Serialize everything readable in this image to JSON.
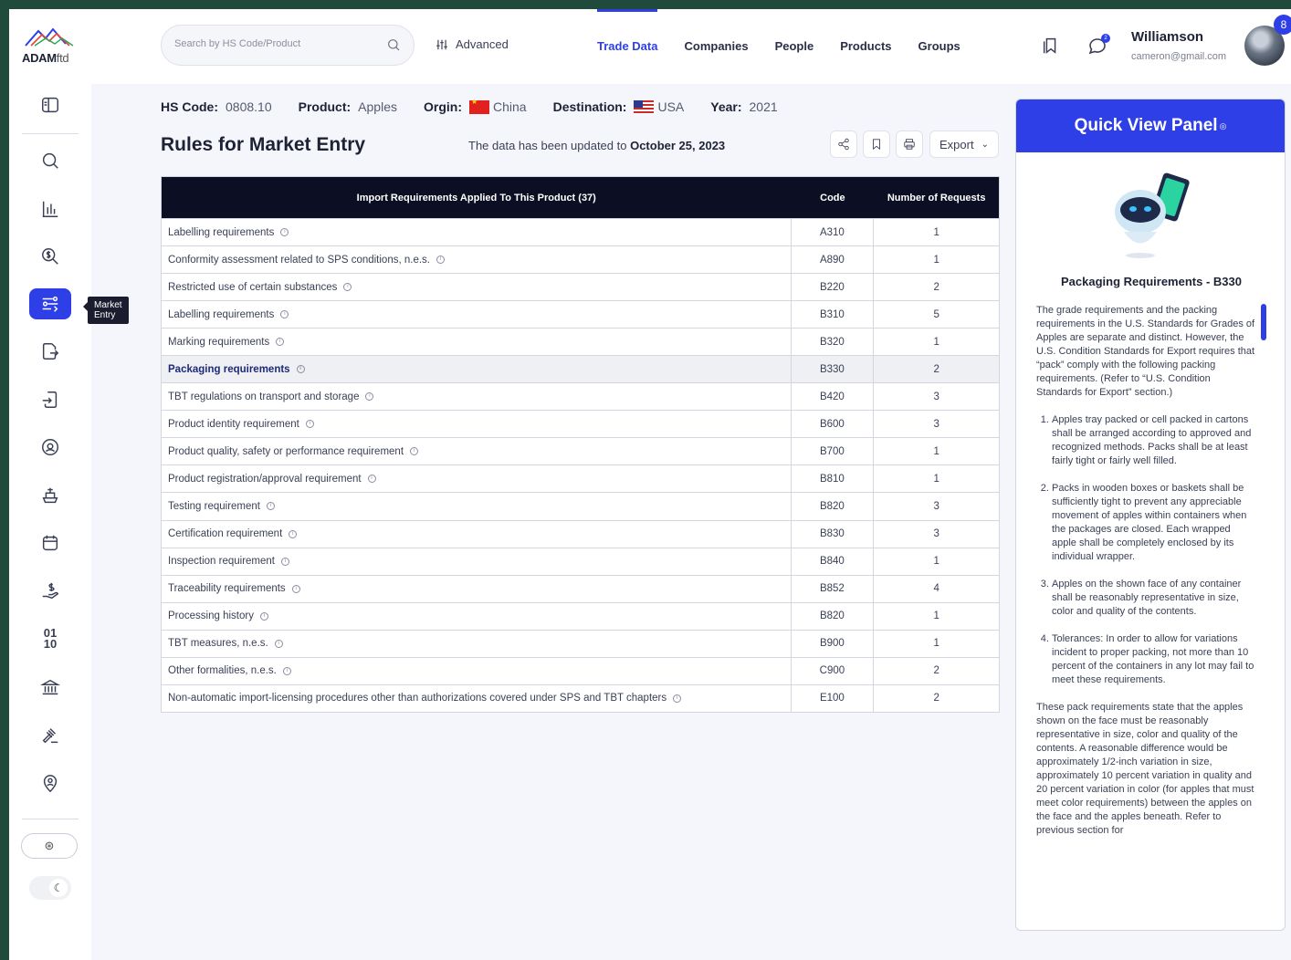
{
  "brand": {
    "name_bold": "ADAM",
    "name_light": "ftd"
  },
  "sidebar": {
    "items": [
      {
        "name": "sidebar-panel-icon"
      },
      {
        "name": "search-icon"
      },
      {
        "name": "bar-chart-icon"
      },
      {
        "name": "dollar-search-icon"
      },
      {
        "name": "market-entry-icon",
        "active": true
      },
      {
        "name": "export-doc-icon"
      },
      {
        "name": "import-doc-icon"
      },
      {
        "name": "location-icon"
      },
      {
        "name": "ship-icon"
      },
      {
        "name": "calendar-icon"
      },
      {
        "name": "hand-dollar-icon"
      },
      {
        "name": "binary-icon"
      },
      {
        "name": "bank-icon"
      },
      {
        "name": "gavel-icon"
      },
      {
        "name": "person-location-icon"
      }
    ],
    "tooltip": "Market Entry"
  },
  "header": {
    "search_placeholder": "Search by HS Code/Product",
    "advanced_label": "Advanced",
    "nav": [
      "Trade Data",
      "Companies",
      "People",
      "Products",
      "Groups"
    ],
    "active_nav": "Trade Data",
    "notification_badge": "2",
    "user_name": "Williamson",
    "user_email": "cameron@gmail.com",
    "avatar_badge": "8"
  },
  "meta": {
    "hs_label": "HS Code:",
    "hs_value": "0808.10",
    "product_label": "Product:",
    "product_value": "Apples",
    "origin_label": "Orgin:",
    "origin_value": "China",
    "destination_label": "Destination:",
    "destination_value": "USA",
    "year_label": "Year:",
    "year_value": "2021"
  },
  "page": {
    "title": "Rules for Market Entry",
    "updated_prefix": "The data has been updated to ",
    "updated_date": "October 25, 2023",
    "export_label": "Export"
  },
  "table": {
    "headers": [
      "Import Requirements Applied To This Product  (37)",
      "Code",
      "Number of Requests"
    ],
    "rows": [
      {
        "req": "Labelling requirements",
        "code": "A310",
        "count": "1"
      },
      {
        "req": "Conformity assessment related to SPS conditions, n.e.s.",
        "code": "A890",
        "count": "1"
      },
      {
        "req": "Restricted use of certain substances",
        "code": "B220",
        "count": "2"
      },
      {
        "req": "Labelling requirements",
        "code": "B310",
        "count": "5"
      },
      {
        "req": "Marking requirements",
        "code": "B320",
        "count": "1"
      },
      {
        "req": "Packaging requirements",
        "code": "B330",
        "count": "2",
        "selected": true
      },
      {
        "req": "TBT regulations on transport and storage",
        "code": "B420",
        "count": "3"
      },
      {
        "req": "Product identity requirement",
        "code": "B600",
        "count": "3"
      },
      {
        "req": "Product quality, safety or performance requirement",
        "code": "B700",
        "count": "1"
      },
      {
        "req": "Product registration/approval requirement",
        "code": "B810",
        "count": "1"
      },
      {
        "req": "Testing requirement",
        "code": "B820",
        "count": "3"
      },
      {
        "req": "Certification requirement",
        "code": "B830",
        "count": "3"
      },
      {
        "req": "Inspection requirement",
        "code": "B840",
        "count": "1"
      },
      {
        "req": "Traceability requirements",
        "code": "B852",
        "count": "4"
      },
      {
        "req": "Processing history",
        "code": "B820",
        "count": "1"
      },
      {
        "req": "TBT measures, n.e.s.",
        "code": "B900",
        "count": "1"
      },
      {
        "req": "Other formalities, n.e.s.",
        "code": "C900",
        "count": "2"
      },
      {
        "req": "Non-automatic import-licensing procedures other than authorizations covered under SPS and TBT chapters",
        "code": "E100",
        "count": "2"
      }
    ]
  },
  "quick_view": {
    "title": "Quick View Panel",
    "subtitle": "Packaging Requirements - B330",
    "intro": "The grade requirements and the packing requirements in the U.S. Standards for Grades of Apples are separate and distinct. However, the U.S. Condition Standards for Export requires that “pack” comply with the following packing requirements. (Refer to “U.S. Condition Standards for Export” section.)",
    "items": [
      "Apples tray packed or cell packed in cartons shall be arranged according to approved and recognized methods. Packs shall be at least fairly tight or fairly well filled.",
      "Packs in wooden boxes or baskets shall be sufficiently tight to prevent any appreciable movement of apples within containers when the packages are closed. Each wrapped apple shall be completely enclosed by its individual wrapper.",
      "Apples on the shown face of any container shall be reasonably representative in size, color and quality of the contents.",
      "Tolerances: In order to allow for variations incident to proper packing, not more than 10 percent of the containers in any lot may fail to meet these requirements."
    ],
    "closing": "These pack requirements state that the apples shown on the face must be reasonably representative in size, color and quality of the contents. A reasonable difference would be approximately 1/2-inch variation in size, approximately 10 percent variation in quality and 20 percent variation in color (for apples that must meet color requirements) between the apples on the face and the apples beneath. Refer to previous section for"
  },
  "colors": {
    "accent": "#2f3fe8",
    "table_header": "#0c0f24",
    "frame": "#1f4a3c"
  }
}
